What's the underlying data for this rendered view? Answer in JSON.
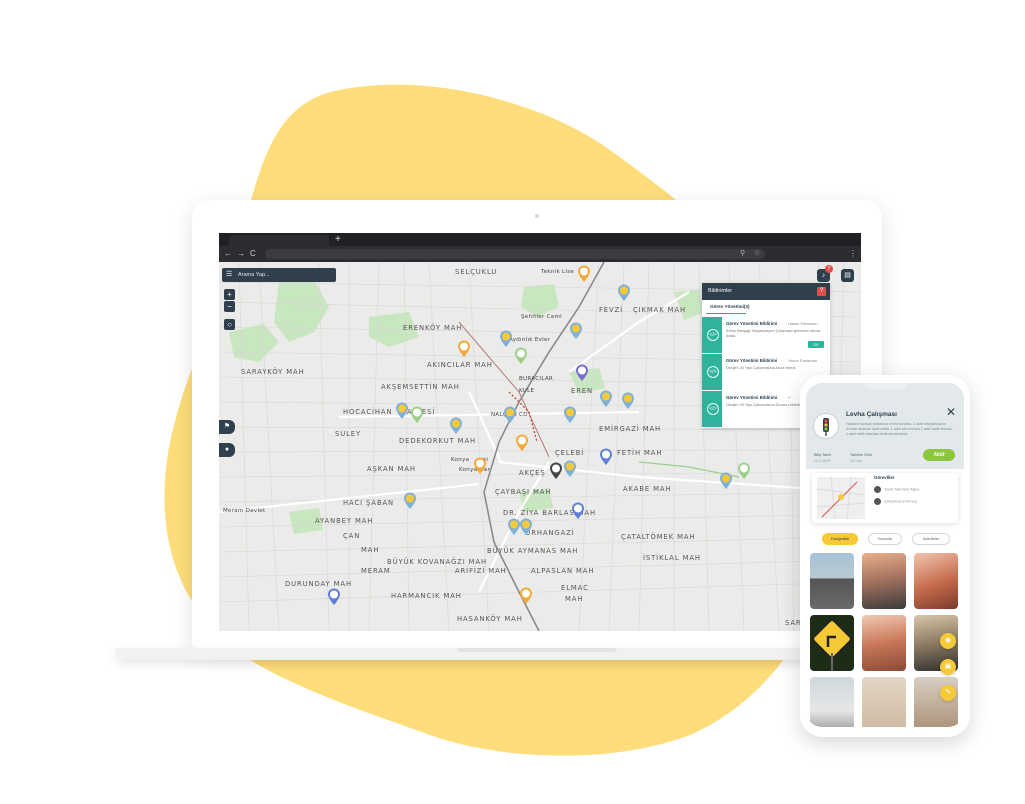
{
  "colors": {
    "blob": "#fedd7a",
    "toolbar_dark": "#2f3f4c",
    "accent_green": "#2fb39a",
    "alert_red": "#e74c4c",
    "badge_yellow": "#f6c937",
    "aktif_green": "#8cc63f"
  },
  "browser": {
    "new_tab": "+",
    "back": "←",
    "forward": "→",
    "reload": "C",
    "menu": "⋮"
  },
  "map": {
    "search_placeholder": "Arama Yap...",
    "zoom_in": "+",
    "zoom_out": "−",
    "notification_count": "7",
    "labels": [
      "SELÇUKLU",
      "Teknik Lise",
      "ÇIKMAK MAH",
      "FEVZİ",
      "Şehitler Cami",
      "ERENKÖY MAH",
      "Aydınlık Evler",
      "AKINCILAR MAH",
      "SARAYKÖY MAH",
      "AKŞEMSETTİN MAH",
      "BURACILAR",
      "EREN",
      "KULE",
      "HOCACİHAN",
      "HALLESİ",
      "SULEY",
      "DEDEKORKUT MAH",
      "NALÇACI CD",
      "EMİRGAZİ MAH",
      "ÇELEBİ",
      "FETİH MAH",
      "Konya",
      "mai",
      "Konya Gar",
      "AŞKAN MAH",
      "AKÇEŞ",
      "AKABE MAH",
      "ÇAYBAŞI MAH",
      "HACI ŞABAN",
      "DR. ZİYA BARLAS MAH",
      "Meram Devlet",
      "AYANBEY MAH",
      "ÇAN",
      "MAH",
      "BÜYÜK KOVANAĞZI MAH",
      "ORHANGAZİ",
      "ÇATALTÖMEK MAH",
      "BÜYÜK AYMANAS MAH",
      "MERAM",
      "ARİFİZİ MAH",
      "ALPASLAN MAH",
      "İSTİKLAL MAH",
      "DURUNDAY MAH",
      "HARMANCIK MAH",
      "ELMAC",
      "MAH",
      "HASANKÖY MAH",
      "SARAÇOĞLU MA"
    ]
  },
  "notifications": {
    "title": "Bildirimler",
    "close": "?",
    "tab": "Görev Yönetimi(3)",
    "items": [
      {
        "title": "Görev Yönetimi Bildirimi",
        "from": "Haşim Parlaman",
        "body": "Kulüp Kavşağı Sinyalizasyon Çalışması görevinin süresi doldu.",
        "action": "OK"
      },
      {
        "title": "Görev Yönetimi Bildirimi",
        "from": "Yavuz Parlaman",
        "body": "Oksijen 40 Yapı Çalışmasına Arıza ekledi.",
        "action": ""
      },
      {
        "title": "Görev Yönetimi Bildirimi",
        "from": "Y",
        "body": "Oksijen 40 Yapı Çalışmasına Duvarcı ekledi.",
        "action": ""
      }
    ]
  },
  "phone": {
    "title": "Levha Çalışması",
    "description": "Hastane kavşak noktasına levha konuldu. 2 adet sinyalizasyon levhası sisteme dahil edildi. 1 adet yön levhası 1 adet trafik levhası. 1 adet trafik tabelası eksik tamamlandı.",
    "close": "✕",
    "start_label": "Bitiş Tarihi",
    "start_value": "12.3.2019",
    "end_label": "Tahmini Süre",
    "end_value": "10 Gün",
    "status": "Aktif",
    "card_title": "Görevliler",
    "people": [
      "Yasin Mehmet Ağca",
      "Süleyman Durmuş"
    ],
    "tabs": [
      "Fotoğraflar",
      "Yorumlar",
      "Aktiviteler"
    ]
  }
}
